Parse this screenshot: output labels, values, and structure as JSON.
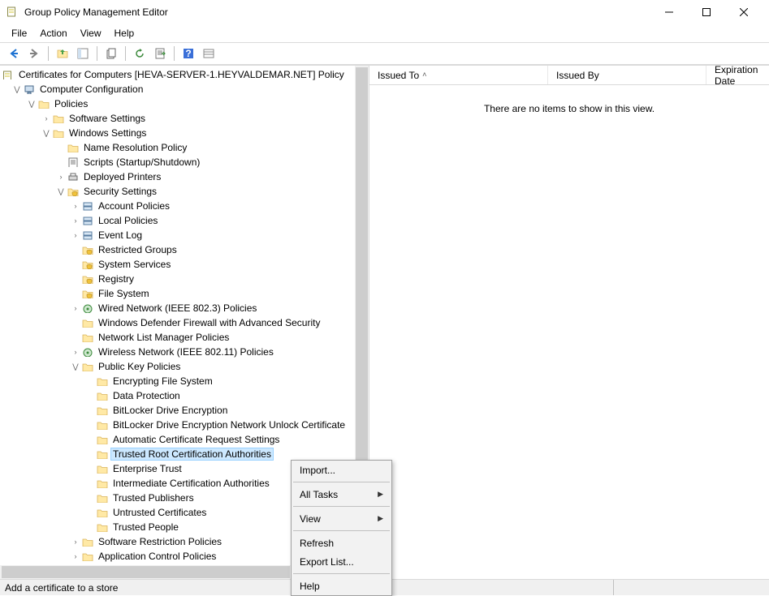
{
  "window": {
    "title": "Group Policy Management Editor"
  },
  "menu": {
    "file": "File",
    "action": "Action",
    "view": "View",
    "help": "Help"
  },
  "root": {
    "label": "Certificates for Computers [HEVA-SERVER-1.HEYVALDEMAR.NET] Policy"
  },
  "tree": {
    "computer_config": "Computer Configuration",
    "policies": "Policies",
    "software_settings": "Software Settings",
    "windows_settings": "Windows Settings",
    "name_resolution": "Name Resolution Policy",
    "scripts": "Scripts (Startup/Shutdown)",
    "deployed_printers": "Deployed Printers",
    "security_settings": "Security Settings",
    "account_policies": "Account Policies",
    "local_policies": "Local Policies",
    "event_log": "Event Log",
    "restricted_groups": "Restricted Groups",
    "system_services": "System Services",
    "registry": "Registry",
    "file_system": "File System",
    "wired_network": "Wired Network (IEEE 802.3) Policies",
    "firewall": "Windows Defender Firewall with Advanced Security",
    "network_list": "Network List Manager Policies",
    "wireless_network": "Wireless Network (IEEE 802.11) Policies",
    "public_key_policies": "Public Key Policies",
    "efs": "Encrypting File System",
    "data_protection": "Data Protection",
    "bitlocker": "BitLocker Drive Encryption",
    "bitlocker_unlock": "BitLocker Drive Encryption Network Unlock Certificate",
    "auto_cert": "Automatic Certificate Request Settings",
    "trusted_root": "Trusted Root Certification Authorities",
    "enterprise_trust": "Enterprise Trust",
    "intermediate_ca": "Intermediate Certification Authorities",
    "trusted_publishers": "Trusted Publishers",
    "untrusted_certs": "Untrusted Certificates",
    "trusted_people": "Trusted People",
    "software_restriction": "Software Restriction Policies",
    "app_control": "Application Control Policies"
  },
  "columns": {
    "issued_to": "Issued To",
    "issued_by": "Issued By",
    "expiration": "Expiration Date"
  },
  "list": {
    "empty": "There are no items to show in this view."
  },
  "context_menu": {
    "import": "Import...",
    "all_tasks": "All Tasks",
    "view": "View",
    "refresh": "Refresh",
    "export_list": "Export List...",
    "help": "Help"
  },
  "status": {
    "text": "Add a certificate to a store"
  }
}
